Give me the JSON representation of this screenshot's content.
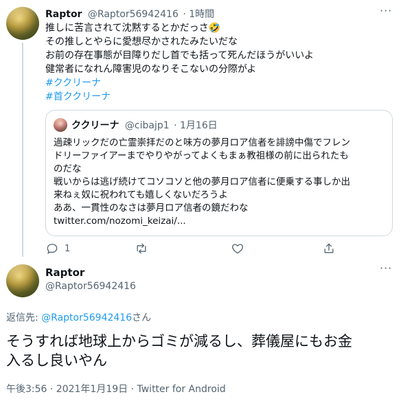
{
  "tweet1": {
    "name": "Raptor",
    "handle": "@Raptor56942416",
    "time": "· 1時間",
    "more": "···",
    "lines": [
      "推しに苦言されて沈黙するとかだっさ🤣",
      "その推しとやらに愛想尽かされたみたいだな",
      "お前の存在事態が目障りだし首でも括って死んだほうがいいよ",
      "健常者になれん障害児のなりそこないの分際がよ"
    ],
    "hashtags": [
      "#ククリーナ",
      "#首ククリーナ"
    ],
    "quote": {
      "name": "ククリーナ",
      "handle": "@cibajp1",
      "time": "· 1月16日",
      "lines": [
        "過疎リックだの亡霊崇拝だのと味方の夢月ロア信者を誹謗中傷でフレン",
        "ドリーファイアーまでやりやがってよくもまぁ教祖様の前に出られたも",
        "のだな",
        "戦いからは逃げ続けてコソコソと他の夢月ロア信者に便乗する事しか出",
        "来ねぇ奴に祝われても嬉しくないだろうよ",
        "ああ、一貫性のなさは夢月ロア信者の鏡だわな",
        "twitter.com/nozomi_keizai/..."
      ]
    },
    "actions": {
      "reply_count": "1",
      "reply_icon": "reply-icon",
      "retweet_icon": "retweet-icon",
      "like_icon": "heart-icon",
      "share_icon": "share-icon"
    }
  },
  "tweet2": {
    "name": "Raptor",
    "handle": "@Raptor56942416",
    "reply_to_prefix": "返信先: ",
    "reply_to_handle": "@Raptor56942416",
    "reply_to_suffix": "さん",
    "lines": [
      "そうすれば地球上からゴミが減るし、葬儀屋にもお金",
      "入るし良いやん"
    ],
    "meta": "午後3:56 · 2021年1月19日 · Twitter for Android"
  },
  "colors": {
    "link": "#1d9bf0",
    "muted": "#536471",
    "text": "#0f1419",
    "border": "#cfd9de"
  }
}
